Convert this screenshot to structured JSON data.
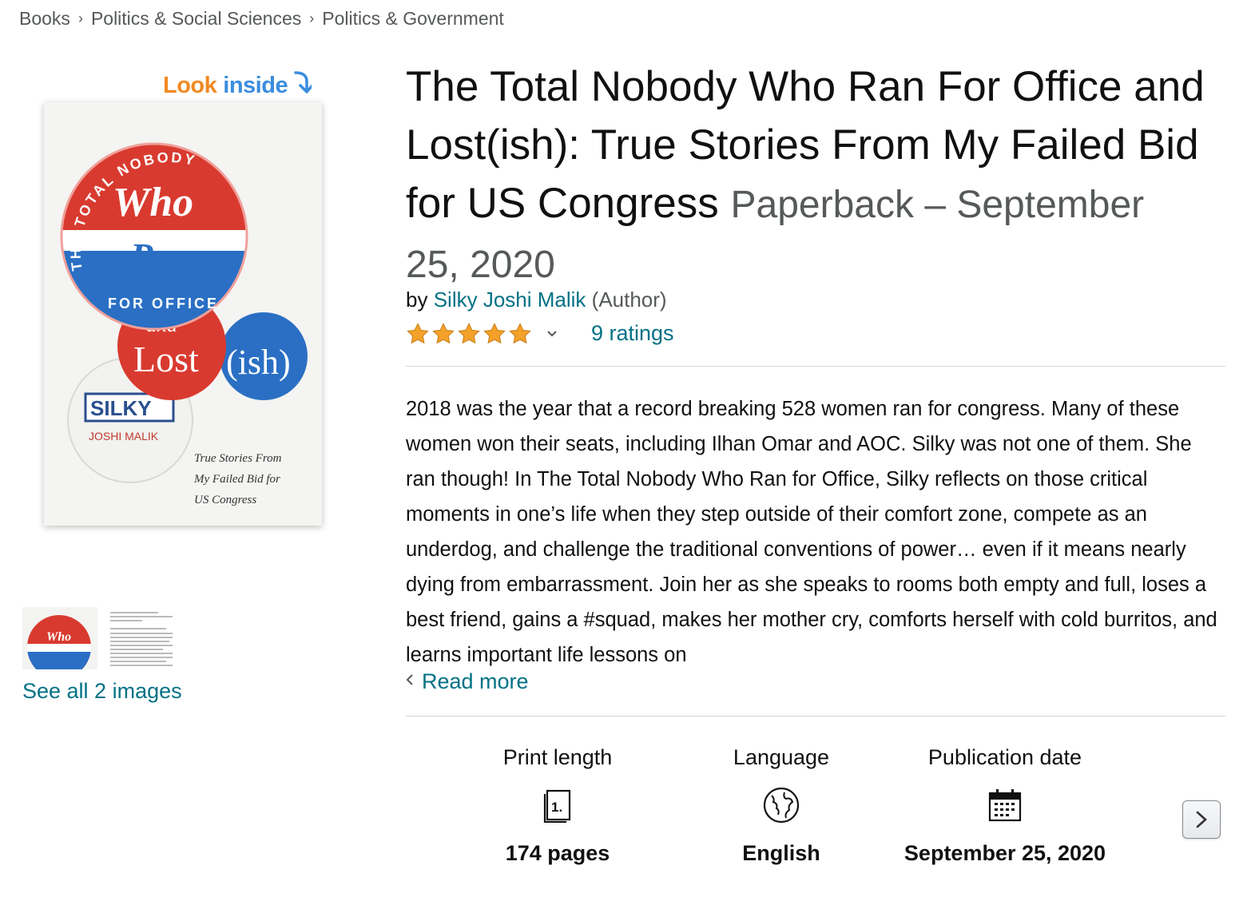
{
  "breadcrumb": {
    "items": [
      "Books",
      "Politics & Social Sciences",
      "Politics & Government"
    ],
    "separator": "›"
  },
  "look_inside": {
    "part1": "Look",
    "part2": "inside"
  },
  "cover": {
    "badge_top_text": "THE TOTAL NOBODY",
    "badge_word1": "Who",
    "badge_word2": "Ran",
    "badge_bottom_text": "FOR OFFICE",
    "and_text": "and",
    "lost_text": "Lost",
    "ish_text": "(ish)",
    "silky_text": "SILKY",
    "author_line": "JOSHI MALIK",
    "subtitle_lines": [
      "True Stories From",
      "My Failed Bid for",
      "US Congress"
    ]
  },
  "gallery": {
    "see_all": "See all 2 images"
  },
  "product": {
    "title": "The Total Nobody Who Ran For Office and Lost(ish): True Stories From My Failed Bid for US Congress",
    "format": "Paperback – September 25, 2020",
    "by_label": "by",
    "author": "Silky Joshi Malik",
    "author_role": "(Author)",
    "ratings_label": "9 ratings",
    "star_rating": 5,
    "description": "2018 was the year that a record breaking 528 women ran for congress. Many of these women won their seats, including Ilhan Omar and AOC. Silky was not one of them. She ran though! In The Total Nobody Who Ran for Office, Silky reflects on those critical moments in one’s life when they step outside of their comfort zone, compete as an underdog, and challenge the traditional conventions of power… even if it means nearly dying from embarrassment. Join her as she speaks to rooms both empty and full, loses a best friend, gains a #squad, makes her mother cry, comforts herself with cold burritos, and learns important life lessons on",
    "read_more": "Read more"
  },
  "details": [
    {
      "label": "Print length",
      "icon": "book-pages-icon",
      "value": "174 pages"
    },
    {
      "label": "Language",
      "icon": "globe-icon",
      "value": "English"
    },
    {
      "label": "Publication date",
      "icon": "calendar-icon",
      "value": "September 25, 2020"
    }
  ],
  "colors": {
    "link": "#007185",
    "star": "#f4a12a",
    "look_orange": "#f08a24",
    "look_blue": "#3a8dde",
    "badge_red": "#d93a2f",
    "badge_blue": "#2a6fc4"
  }
}
